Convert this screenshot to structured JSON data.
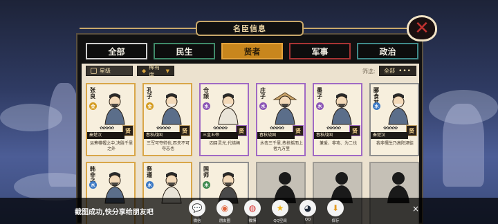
{
  "header": {
    "title": "名臣信息"
  },
  "tabs": [
    {
      "label": "全部",
      "active": false
    },
    {
      "label": "民生",
      "active": false
    },
    {
      "label": "贤者",
      "active": true
    },
    {
      "label": "军事",
      "active": false
    },
    {
      "label": "政治",
      "active": false
    }
  ],
  "filters": {
    "star_label": "星级",
    "rarity_label": "稀有度",
    "screen_label": "筛选:",
    "scope_value": "全部",
    "more_glyph": "•••"
  },
  "cards": [
    {
      "name": "张良",
      "element": "金",
      "element_color": "gold",
      "frame": "gold",
      "era": "秦楚汉",
      "badge": "贤",
      "motto": "运筹帷幄之中,决胜千里之外",
      "stars": "✿✿✿✿✿",
      "locked": false,
      "portrait": "robed-sage"
    },
    {
      "name": "孔子",
      "element": "金",
      "element_color": "gold",
      "frame": "gold",
      "era": "春秋战国",
      "badge": "贤",
      "motto": "三军可夺帅也,匹夫不可夺志也",
      "stars": "✿✿✿✿✿",
      "locked": false,
      "portrait": "old-teacher"
    },
    {
      "name": "仓颉",
      "element": "水",
      "element_color": "purple",
      "frame": "purple",
      "era": "三皇五帝",
      "badge": "贤",
      "motto": "四目灵光,代结绳",
      "stars": "✿✿✿✿✿",
      "locked": false,
      "portrait": "white-hair-sage"
    },
    {
      "name": "庄子",
      "element": "水",
      "element_color": "purple",
      "frame": "purple",
      "era": "春秋战国",
      "badge": "贤",
      "motto": "水击三千里,抟扶摇而上者九万里",
      "stars": "✿✿✿✿✿",
      "locked": false,
      "portrait": "straw-hat-sage"
    },
    {
      "name": "墨子",
      "element": "水",
      "element_color": "purple",
      "frame": "purple",
      "era": "春秋战国",
      "badge": "贤",
      "motto": "兼爱、非攻、为二也",
      "stars": "✿✿✿✿✿",
      "locked": false,
      "portrait": "bald-sage"
    },
    {
      "name": "郦食其",
      "element": "水",
      "element_color": "water",
      "frame": "gray",
      "era": "秦楚汉",
      "badge": "贤",
      "motto": "我非儒生乃高阳酒徒",
      "stars": "✿✿✿✿✿",
      "locked": false,
      "portrait": "bearded-elder"
    },
    {
      "name": "韩非子",
      "element": "水",
      "element_color": "water",
      "frame": "gold",
      "era": "",
      "badge": "",
      "motto": "",
      "stars": "",
      "locked": false,
      "portrait": "scholar"
    },
    {
      "name": "祭遵",
      "element": "水",
      "element_color": "water",
      "frame": "gold",
      "era": "",
      "badge": "",
      "motto": "",
      "stars": "",
      "locked": false,
      "portrait": "white-robed"
    },
    {
      "name": "国师",
      "element": "木",
      "element_color": "wood",
      "frame": "gray",
      "era": "",
      "badge": "",
      "motto": "",
      "stars": "",
      "locked": false,
      "portrait": "staff-master"
    },
    {
      "name": "",
      "element": "",
      "element_color": "",
      "frame": "locked",
      "era": "",
      "badge": "",
      "motto": "",
      "stars": "",
      "locked": true,
      "portrait": "silhouette"
    },
    {
      "name": "",
      "element": "",
      "element_color": "",
      "frame": "locked",
      "era": "",
      "badge": "",
      "motto": "",
      "stars": "",
      "locked": true,
      "portrait": "silhouette"
    },
    {
      "name": "",
      "element": "",
      "element_color": "",
      "frame": "locked",
      "era": "",
      "badge": "",
      "motto": "",
      "stars": "",
      "locked": true,
      "portrait": "silhouette"
    }
  ],
  "share": {
    "message": "截图成功,快分享给朋友吧",
    "close_glyph": "×",
    "items": [
      {
        "label": "微信",
        "icon": "wechat-icon",
        "glyph": "💬",
        "color": "#2aae67"
      },
      {
        "label": "朋友圈",
        "icon": "moments-icon",
        "glyph": "◉",
        "color": "#e0643c"
      },
      {
        "label": "微博",
        "icon": "weibo-icon",
        "glyph": "◍",
        "color": "#d8302f"
      },
      {
        "label": "QQ空间",
        "icon": "qzone-icon",
        "glyph": "★",
        "color": "#f2b61c"
      },
      {
        "label": "QQ",
        "icon": "qq-icon",
        "glyph": "◕",
        "color": "#1f2a3a"
      },
      {
        "label": "保存",
        "icon": "save-icon",
        "glyph": "⬇",
        "color": "#e39a22"
      }
    ]
  },
  "colors": {
    "accent": "#c8861d",
    "panel_bg": "#ece2cf",
    "gold_frame": "#d9a648",
    "purple_frame": "#a069c4"
  }
}
